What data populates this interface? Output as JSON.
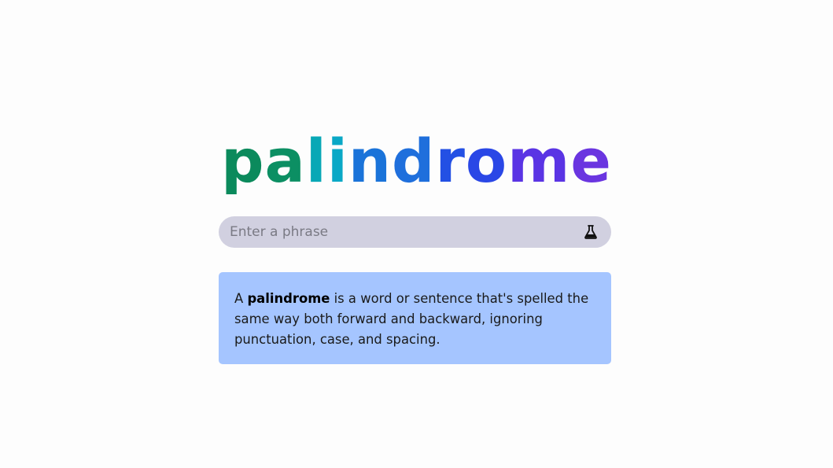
{
  "logo": {
    "letters": [
      {
        "char": "p",
        "color": "#0b8a5c"
      },
      {
        "char": "a",
        "color": "#0c8f63"
      },
      {
        "char": "l",
        "color": "#08a8b6"
      },
      {
        "char": "i",
        "color": "#0aa8c6"
      },
      {
        "char": "n",
        "color": "#1a73d9"
      },
      {
        "char": "d",
        "color": "#1f6fdc"
      },
      {
        "char": "r",
        "color": "#2350e4"
      },
      {
        "char": "o",
        "color": "#2a47e6"
      },
      {
        "char": "m",
        "color": "#5a34e4"
      },
      {
        "char": "e",
        "color": "#6a35e0"
      }
    ]
  },
  "search": {
    "placeholder": "Enter a phrase",
    "value": "",
    "button_icon": "flask-icon"
  },
  "info": {
    "prefix": "A ",
    "term": "palindrome",
    "description": " is a word or sentence that's spelled the same way both forward and backward, ignoring punctuation, case, and spacing."
  },
  "colors": {
    "search_bg": "#d1d0e0",
    "info_bg": "#a5c5ff"
  }
}
